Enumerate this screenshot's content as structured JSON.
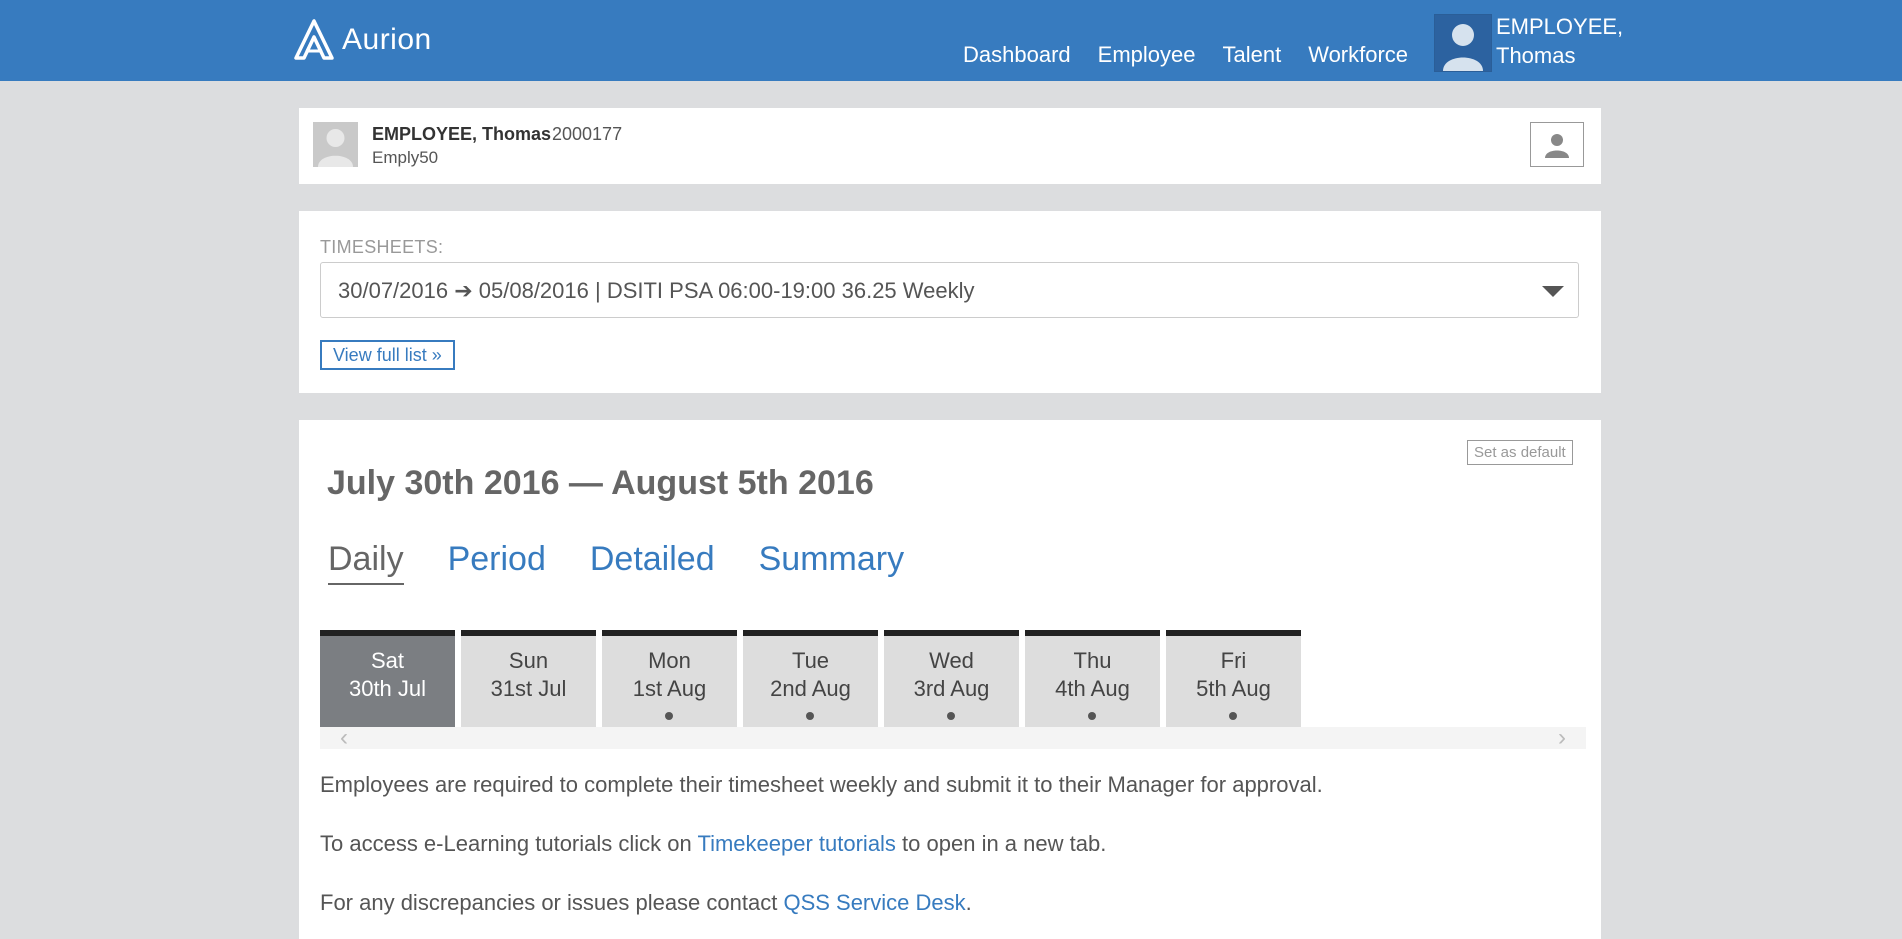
{
  "app": {
    "logo_text": "Aurion",
    "nav": [
      "Dashboard",
      "Employee",
      "Talent",
      "Workforce"
    ],
    "user_line1": "EMPLOYEE,",
    "user_line2": "Thomas"
  },
  "employee": {
    "name": "EMPLOYEE, Thomas",
    "id": "2000177",
    "code": "Emply50"
  },
  "timesheets": {
    "label": "TIMESHEETS:",
    "selected": "30/07/2016 ➔ 05/08/2016 | DSITI PSA 06:00-19:00 36.25 Weekly",
    "view_full": "View full list »"
  },
  "period": {
    "set_default": "Set as default",
    "title": "July 30th 2016 — August 5th 2016",
    "tabs": [
      "Daily",
      "Period",
      "Detailed",
      "Summary"
    ],
    "active_tab": "Daily",
    "days": [
      {
        "name": "Sat",
        "date": "30th Jul",
        "active": true,
        "dot": false
      },
      {
        "name": "Sun",
        "date": "31st Jul",
        "active": false,
        "dot": false
      },
      {
        "name": "Mon",
        "date": "1st Aug",
        "active": false,
        "dot": true
      },
      {
        "name": "Tue",
        "date": "2nd Aug",
        "active": false,
        "dot": true
      },
      {
        "name": "Wed",
        "date": "3rd Aug",
        "active": false,
        "dot": true
      },
      {
        "name": "Thu",
        "date": "4th Aug",
        "active": false,
        "dot": true
      },
      {
        "name": "Fri",
        "date": "5th Aug",
        "active": false,
        "dot": true
      }
    ]
  },
  "notes": {
    "p1": "Employees are required to complete their timesheet weekly and submit it to their Manager for approval.",
    "p2_before": "To access e-Learning tutorials click on ",
    "p2_link": "Timekeeper tutorials",
    "p2_after": " to open in a new tab.",
    "p3_before": "For any discrepancies or issues please contact ",
    "p3_link": "QSS Service Desk",
    "p3_after": "."
  },
  "colors": {
    "brand": "#377bbf",
    "background": "#dcdddf",
    "active_day": "#7b7e82"
  }
}
